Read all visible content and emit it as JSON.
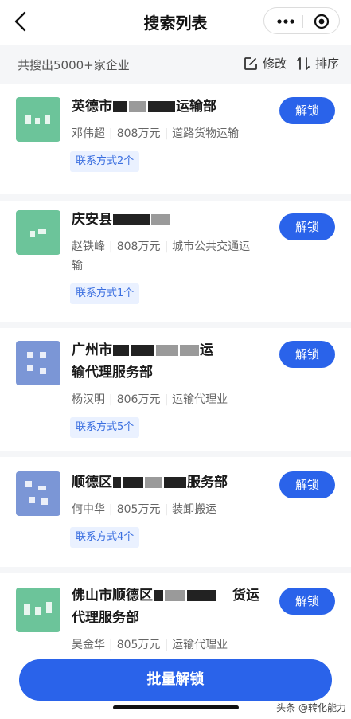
{
  "nav": {
    "title": "搜索列表"
  },
  "subbar": {
    "count_text": "共搜出5000+家企业",
    "edit_label": "修改",
    "sort_label": "排序"
  },
  "companies": [
    {
      "name_prefix": "英德市",
      "name_suffix": "运输部",
      "legal_person": "邓伟超",
      "capital": "808万元",
      "industry": "道路货物运输",
      "contact": "联系方式2个",
      "unlock_label": "解锁",
      "logo_color": "#6cc49a"
    },
    {
      "name_prefix": "庆安县",
      "name_suffix": "",
      "legal_person": "赵铁峰",
      "capital": "808万元",
      "industry_line1": "城市公共交通运",
      "industry_line2": "输",
      "contact": "联系方式1个",
      "unlock_label": "解锁",
      "logo_color": "#6cc49a"
    },
    {
      "name_prefix": "广州市",
      "name_suffix": "运",
      "name_line2": "输代理服务部",
      "legal_person": "杨汉明",
      "capital": "806万元",
      "industry": "运输代理业",
      "contact": "联系方式5个",
      "unlock_label": "解锁",
      "logo_color": "#7b96d6"
    },
    {
      "name_prefix": "顺德区",
      "name_suffix": "服务部",
      "legal_person": "何中华",
      "capital": "805万元",
      "industry": "装卸搬运",
      "contact": "联系方式4个",
      "unlock_label": "解锁",
      "logo_color": "#7b96d6"
    },
    {
      "name_prefix": "佛山市顺德区",
      "name_suffix": "货运",
      "name_line2": "代理服务部",
      "legal_person": "吴金华",
      "capital": "805万元",
      "industry": "运输代理业",
      "unlock_label": "解锁",
      "logo_color": "#6cc49a"
    }
  ],
  "bottom": {
    "button_label": "批量解锁"
  },
  "watermark": "头条 @转化能力",
  "colors": {
    "accent": "#2a63ea",
    "tag_bg": "#eaf1ff",
    "tag_text": "#3b6fe0",
    "green_logo": "#6cc49a",
    "blue_logo": "#7b96d6"
  }
}
